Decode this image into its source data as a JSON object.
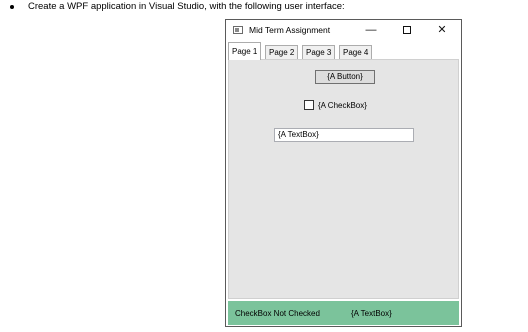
{
  "instruction": "Create a WPF application in Visual Studio, with the following user interface:",
  "window": {
    "title": "Mid Term Assignment",
    "controls": {
      "minimize": "—",
      "maximize": "☐",
      "close": "✕"
    }
  },
  "tabs": [
    {
      "label": "Page 1",
      "selected": true
    },
    {
      "label": "Page 2",
      "selected": false
    },
    {
      "label": "Page 3",
      "selected": false
    },
    {
      "label": "Page 4",
      "selected": false
    }
  ],
  "content": {
    "button_label": "{A Button}",
    "checkbox_label": "{A CheckBox}",
    "checkbox_checked": false,
    "textbox_value": "{A TextBox}"
  },
  "statusbar": {
    "left_text": "CheckBox Not Checked",
    "right_text": "{A TextBox}",
    "color": "#7bc39b"
  }
}
